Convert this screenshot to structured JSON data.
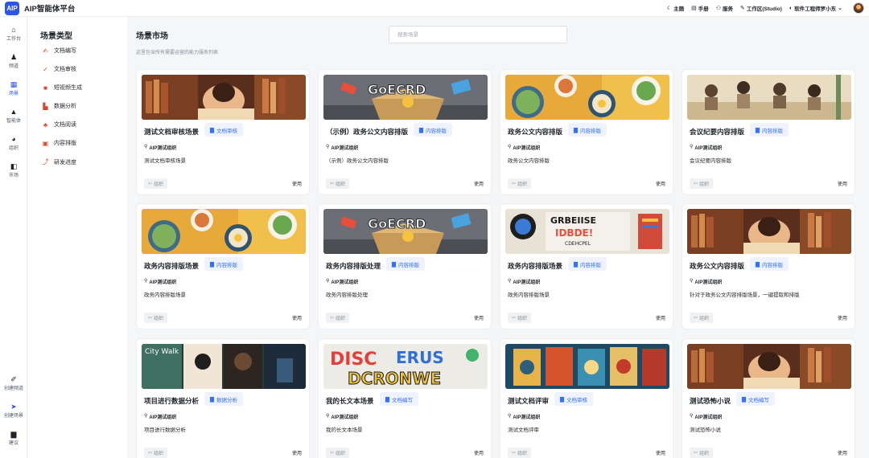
{
  "app": {
    "logo_text": "AIP",
    "title": "AIP智能体平台"
  },
  "topnav": [
    {
      "icon": "moon-icon",
      "glyph": "☾",
      "label": "主题"
    },
    {
      "icon": "manual-icon",
      "glyph": "▤",
      "label": "手册"
    },
    {
      "icon": "service-icon",
      "glyph": "⚇",
      "label": "服务"
    },
    {
      "icon": "pen-icon",
      "glyph": "✎",
      "label": "工作区(Studio)"
    },
    {
      "icon": "user-circle-icon",
      "glyph": "◐",
      "label": "软件工程师罗小东"
    }
  ],
  "user_dropdown_glyph": "⌄",
  "leftnav": {
    "top": [
      {
        "glyph": "⌂",
        "label": "工作台"
      },
      {
        "glyph": "♟",
        "label": "频道"
      },
      {
        "glyph": "▦",
        "label": "场景",
        "active": true
      },
      {
        "glyph": "▲",
        "label": "智能体"
      },
      {
        "glyph": "◕",
        "label": "组织"
      },
      {
        "glyph": "◧",
        "label": "市场"
      }
    ],
    "bottom": [
      {
        "glyph": "✐",
        "label": "创建频道"
      },
      {
        "glyph": "➤",
        "label": "创建场景"
      },
      {
        "glyph": "▆",
        "label": "建议"
      }
    ]
  },
  "categories": {
    "title": "场景类型",
    "items": [
      {
        "glyph": "✍",
        "label": "文档编写"
      },
      {
        "glyph": "✓",
        "label": "文档审核"
      },
      {
        "glyph": "■",
        "label": "短视频生成"
      },
      {
        "glyph": "▙",
        "label": "数据分析"
      },
      {
        "glyph": "♣",
        "label": "文档阅读"
      },
      {
        "glyph": "▣",
        "label": "内容排版"
      },
      {
        "glyph": "⤴",
        "label": "研发进度"
      }
    ]
  },
  "main": {
    "title": "场景市场",
    "description": "这里包含所有需要运营的能力服务列表",
    "search_placeholder": "搜索场景"
  },
  "card_common": {
    "org": "AIP测试组织",
    "group_label": "组织",
    "use_label": "使用"
  },
  "cards": [
    {
      "title": "测试文档审核场景",
      "tag": "文档审核",
      "desc": "测试文档审核场景",
      "image": "library"
    },
    {
      "title": "（示例）政务公文内容排版",
      "tag": "内容排版",
      "desc": "（示例）政务公文内容排版",
      "image": "box"
    },
    {
      "title": "政务公文内容排版",
      "tag": "内容排版",
      "desc": "政务公文内容排版",
      "image": "food"
    },
    {
      "title": "会议纪要内容排版",
      "tag": "内容排版",
      "desc": "会议纪要内容排版",
      "image": "meeting"
    },
    {
      "title": "政务内容排版场景",
      "tag": "内容排版",
      "desc": "政务内容排版场景",
      "image": "food"
    },
    {
      "title": "政务内容排版处理",
      "tag": "内容排版",
      "desc": "政务内容排版处理",
      "image": "box"
    },
    {
      "title": "政务内容排版场景",
      "tag": "内容排版",
      "desc": "政务内容排版场景",
      "image": "desk"
    },
    {
      "title": "政务公文内容排版",
      "tag": "内容排版",
      "desc": "针对于政务公文内容排版场景，一键提取和排版",
      "image": "library"
    },
    {
      "title": "项目进行数据分析",
      "tag": "数据分析",
      "desc": "项目进行数据分析",
      "image": "city"
    },
    {
      "title": "我的长文本场景",
      "tag": "文档编写",
      "desc": "我的长文本场景",
      "image": "graffiti"
    },
    {
      "title": "测试文档评审",
      "tag": "文档审核",
      "desc": "测试文档评审",
      "image": "cards"
    },
    {
      "title": "测试恐怖小说",
      "tag": "文档编写",
      "desc": "测试恐怖小说",
      "image": "library"
    }
  ],
  "colors": {
    "accent": "#2f54eb",
    "tag_text": "#3370ff",
    "tag_bg": "#eef3ff",
    "category_icon": "#e0442a"
  }
}
